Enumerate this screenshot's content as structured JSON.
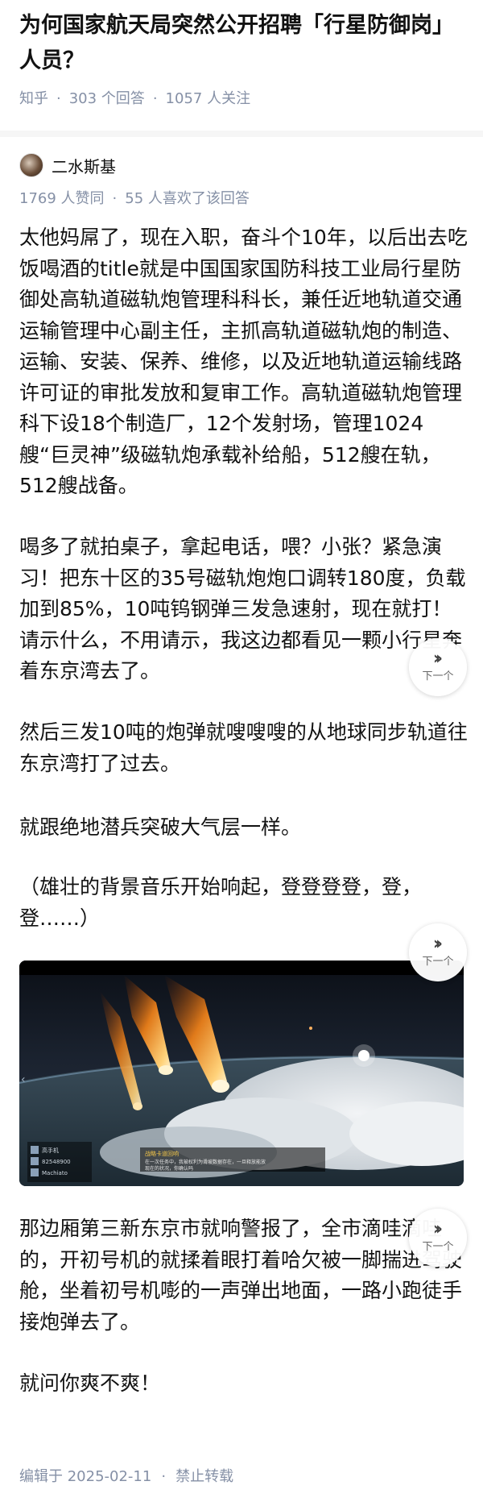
{
  "question": {
    "title": "为何国家航天局突然公开招聘「行星防御岗」人员？",
    "source": "知乎",
    "answers": "303 个回答",
    "followers": "1057 人关注"
  },
  "answer": {
    "author": "二水斯基",
    "upvotes": "1769 人赞同",
    "likes": "55 人喜欢了该回答",
    "paragraphs": [
      "太他妈屌了，现在入职，奋斗个10年，以后出去吃饭喝酒的title就是中国国家国防科技工业局行星防御处高轨道磁轨炮管理科科长，兼任近地轨道交通运输管理中心副主任，主抓高轨道磁轨炮的制造、运输、安装、保养、维修，以及近地轨道运输线路许可证的审批发放和复审工作。高轨道磁轨炮管理科下设18个制造厂，12个发射场，管理1024艘“巨灵神”级磁轨炮承载补给船，512艘在轨，512艘战备。",
      "喝多了就拍桌子，拿起电话，喂？小张？紧急演习！把东十区的35号磁轨炮炮口调转180度，负载加到85%，10吨钨钢弹三发急速射，现在就打！请示什么，不用请示，我这边都看见一颗小行星奔着东京湾去了。",
      "然后三发10吨的炮弹就嗖嗖嗖的从地球同步轨道往东京湾打了过去。",
      "就跟绝地潜兵突破大气层一样。",
      "（雄壮的背景音乐开始响起，登登登登，登，登……）",
      "那边厢第三新东京市就响警报了，全市滴哇滴哇的，开初号机的就揉着眼打着哈欠被一脚揣进驾驶舱，坐着初号机嘭的一声弹出地面，一路小跑徒手接炮弹去了。",
      "就问你爽不爽！"
    ],
    "image": {
      "hud_players": [
        "高手机",
        "82548900",
        "Machiato"
      ],
      "subtitle_title": "战略卡道回响",
      "subtitle_line1": "在一次任务中，我被权利为滑坡数据存在，一旦释放能放",
      "subtitle_line2": "现在的状况，你确认吗"
    }
  },
  "next_button": {
    "label": "下一个"
  },
  "footer": {
    "edited": "编辑于 2025-02-11",
    "copyright": "禁止转载"
  },
  "colors": {
    "text": "#121212",
    "meta": "#8590a6",
    "divider": "#f6f6f6"
  }
}
